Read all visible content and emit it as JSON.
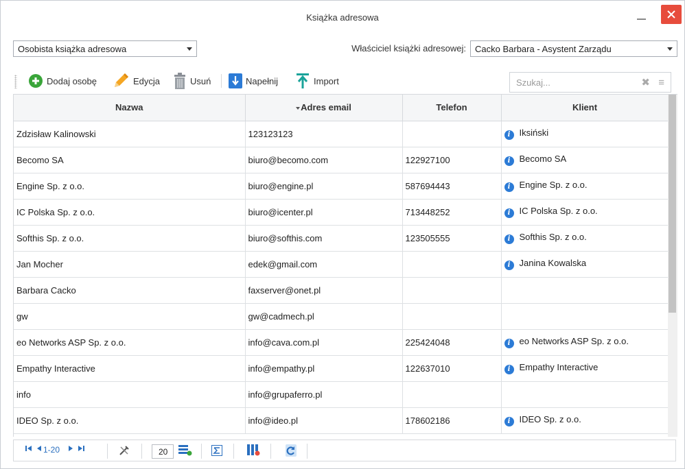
{
  "window": {
    "title": "Książka adresowa"
  },
  "filters": {
    "book_select": "Osobista książka adresowa",
    "owner_label": "Właściciel książki adresowej:",
    "owner_select": "Cacko Barbara - Asystent Zarządu"
  },
  "toolbar": {
    "add": "Dodaj osobę",
    "edit": "Edycja",
    "delete": "Usuń",
    "fill": "Napełnij",
    "import": "Import"
  },
  "search": {
    "placeholder": "Szukaj..."
  },
  "table": {
    "headers": {
      "name": "Nazwa",
      "email": "Adres email",
      "phone": "Telefon",
      "client": "Klient"
    },
    "rows": [
      {
        "name": "Zdzisław Kalinowski",
        "email": "123123123",
        "phone": "",
        "client": "Iksiński"
      },
      {
        "name": "Becomo SA",
        "email": "biuro@becomo.com",
        "phone": "122927100",
        "client": "Becomo SA"
      },
      {
        "name": "Engine Sp. z o.o.",
        "email": "biuro@engine.pl",
        "phone": "587694443",
        "client": "Engine Sp. z o.o."
      },
      {
        "name": "IC Polska Sp. z o.o.",
        "email": "biuro@icenter.pl",
        "phone": "713448252",
        "client": "IC Polska Sp. z o.o."
      },
      {
        "name": "Softhis Sp. z o.o.",
        "email": "biuro@softhis.com",
        "phone": "123505555",
        "client": "Softhis Sp. z o.o."
      },
      {
        "name": "Jan Mocher",
        "email": "edek@gmail.com",
        "phone": "",
        "client": "Janina Kowalska"
      },
      {
        "name": "Barbara Cacko",
        "email": "faxserver@onet.pl",
        "phone": "",
        "client": ""
      },
      {
        "name": "gw",
        "email": "gw@cadmech.pl",
        "phone": "",
        "client": ""
      },
      {
        "name": "eo Networks ASP Sp. z o.o.",
        "email": "info@cava.com.pl",
        "phone": "225424048",
        "client": "eo Networks ASP Sp. z o.o."
      },
      {
        "name": "Empathy Interactive",
        "email": "info@empathy.pl",
        "phone": "122637010",
        "client": "Empathy Interactive"
      },
      {
        "name": "info",
        "email": "info@grupaferro.pl",
        "phone": "",
        "client": ""
      },
      {
        "name": "IDEO Sp. z o.o.",
        "email": "info@ideo.pl",
        "phone": "178602186",
        "client": "IDEO Sp. z o.o."
      }
    ]
  },
  "pager": {
    "range": "1-20",
    "page_size": "20"
  },
  "colors": {
    "accent": "#2c7bd6",
    "close": "#e74c3c",
    "add": "#3aa53a",
    "edit": "#f5a623",
    "import": "#1aa39a"
  }
}
